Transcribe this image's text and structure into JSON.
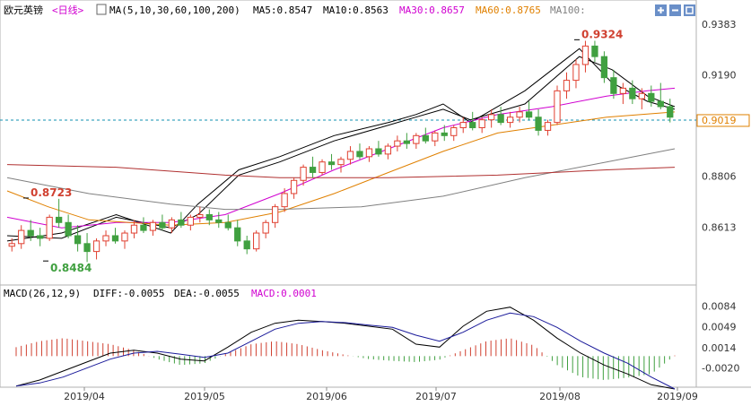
{
  "header": {
    "symbol": "欧元英镑",
    "period": "<日线>",
    "ma_params": "MA(5,10,30,60,100,200)",
    "ma_values": [
      {
        "label": "MA5:0.8547",
        "color": "#000000"
      },
      {
        "label": "MA10:0.8563",
        "color": "#000000"
      },
      {
        "label": "MA30:0.8657",
        "color": "#d000d0"
      },
      {
        "label": "MA60:0.8765",
        "color": "#e08000"
      },
      {
        "label": "MA100:",
        "color": "#808080"
      }
    ],
    "icons": [
      "zoom-in-icon",
      "zoom-out-icon",
      "fullscreen-icon"
    ]
  },
  "macd_header": {
    "params": "MACD(26,12,9)",
    "diff": "DIFF:-0.0055",
    "dea": "DEA:-0.0055",
    "macd": "MACD:0.0001"
  },
  "colors": {
    "up": "#e04030",
    "down": "#40a040",
    "ma5": "#000000",
    "ma10": "#000000",
    "ma30": "#d000d0",
    "ma60": "#e08000",
    "ma100": "#808080",
    "ma200": "#b03030",
    "dash": "#1090b0",
    "macd_pos": "#d04030",
    "macd_neg": "#40a040"
  },
  "chart_data": [
    {
      "type": "candlestick",
      "title": "欧元英镑<日线>",
      "ylim": [
        0.842,
        0.94
      ],
      "y_ticks": [
        0.9383,
        0.919,
        0.9019,
        0.8806,
        0.8613
      ],
      "x_labels": [
        "2019/04",
        "2019/05",
        "2019/06",
        "2019/07",
        "2019/08",
        "2019/09"
      ],
      "current_price": 0.9019,
      "annotations": [
        {
          "text": "0.9324",
          "value": 0.9324,
          "kind": "high"
        },
        {
          "text": "0.8723",
          "value": 0.8723,
          "kind": "high"
        },
        {
          "text": "0.8484",
          "value": 0.8484,
          "kind": "low"
        }
      ],
      "ma_lines": {
        "ma5": [
          [
            0,
            0.856
          ],
          [
            20,
            0.859
          ],
          [
            40,
            0.866
          ],
          [
            60,
            0.859
          ],
          [
            70,
            0.87
          ],
          [
            85,
            0.883
          ],
          [
            100,
            0.888
          ],
          [
            120,
            0.896
          ],
          [
            140,
            0.901
          ],
          [
            150,
            0.904
          ],
          [
            160,
            0.908
          ],
          [
            170,
            0.901
          ],
          [
            190,
            0.913
          ],
          [
            210,
            0.929
          ],
          [
            222,
            0.916
          ],
          [
            235,
            0.909
          ],
          [
            245,
            0.906
          ]
        ],
        "ma10": [
          [
            0,
            0.858
          ],
          [
            20,
            0.857
          ],
          [
            40,
            0.865
          ],
          [
            60,
            0.861
          ],
          [
            70,
            0.866
          ],
          [
            85,
            0.881
          ],
          [
            100,
            0.886
          ],
          [
            120,
            0.894
          ],
          [
            140,
            0.9
          ],
          [
            150,
            0.903
          ],
          [
            160,
            0.906
          ],
          [
            170,
            0.902
          ],
          [
            190,
            0.908
          ],
          [
            210,
            0.926
          ],
          [
            222,
            0.921
          ],
          [
            235,
            0.911
          ],
          [
            245,
            0.907
          ]
        ],
        "ma30": [
          [
            0,
            0.865
          ],
          [
            20,
            0.861
          ],
          [
            40,
            0.863
          ],
          [
            60,
            0.863
          ],
          [
            80,
            0.866
          ],
          [
            100,
            0.874
          ],
          [
            120,
            0.883
          ],
          [
            140,
            0.891
          ],
          [
            160,
            0.899
          ],
          [
            180,
            0.904
          ],
          [
            200,
            0.907
          ],
          [
            220,
            0.911
          ],
          [
            235,
            0.913
          ],
          [
            245,
            0.914
          ]
        ],
        "ma60": [
          [
            0,
            0.875
          ],
          [
            15,
            0.869
          ],
          [
            30,
            0.864
          ],
          [
            60,
            0.862
          ],
          [
            80,
            0.863
          ],
          [
            100,
            0.867
          ],
          [
            120,
            0.874
          ],
          [
            140,
            0.882
          ],
          [
            160,
            0.89
          ],
          [
            180,
            0.897
          ],
          [
            200,
            0.9
          ],
          [
            220,
            0.903
          ],
          [
            245,
            0.905
          ]
        ],
        "ma100": [
          [
            0,
            0.88
          ],
          [
            30,
            0.874
          ],
          [
            60,
            0.87
          ],
          [
            80,
            0.868
          ],
          [
            100,
            0.868
          ],
          [
            130,
            0.869
          ],
          [
            160,
            0.873
          ],
          [
            190,
            0.88
          ],
          [
            220,
            0.886
          ],
          [
            245,
            0.891
          ]
        ],
        "ma200": [
          [
            0,
            0.885
          ],
          [
            40,
            0.884
          ],
          [
            80,
            0.881
          ],
          [
            100,
            0.88
          ],
          [
            140,
            0.88
          ],
          [
            180,
            0.881
          ],
          [
            220,
            0.883
          ],
          [
            245,
            0.884
          ]
        ]
      },
      "candles": [
        [
          0.854,
          0.857,
          0.852,
          0.855
        ],
        [
          0.855,
          0.862,
          0.853,
          0.86
        ],
        [
          0.86,
          0.864,
          0.856,
          0.858
        ],
        [
          0.858,
          0.861,
          0.854,
          0.857
        ],
        [
          0.857,
          0.866,
          0.856,
          0.865
        ],
        [
          0.865,
          0.872,
          0.861,
          0.863
        ],
        [
          0.863,
          0.866,
          0.857,
          0.858
        ],
        [
          0.858,
          0.862,
          0.852,
          0.855
        ],
        [
          0.855,
          0.859,
          0.848,
          0.852
        ],
        [
          0.852,
          0.857,
          0.849,
          0.856
        ],
        [
          0.856,
          0.86,
          0.854,
          0.858
        ],
        [
          0.858,
          0.861,
          0.855,
          0.856
        ],
        [
          0.856,
          0.86,
          0.853,
          0.859
        ],
        [
          0.859,
          0.864,
          0.857,
          0.862
        ],
        [
          0.862,
          0.865,
          0.859,
          0.86
        ],
        [
          0.86,
          0.864,
          0.858,
          0.863
        ],
        [
          0.863,
          0.866,
          0.86,
          0.861
        ],
        [
          0.861,
          0.865,
          0.859,
          0.864
        ],
        [
          0.864,
          0.867,
          0.861,
          0.862
        ],
        [
          0.862,
          0.866,
          0.86,
          0.865
        ],
        [
          0.865,
          0.869,
          0.863,
          0.866
        ],
        [
          0.866,
          0.868,
          0.862,
          0.864
        ],
        [
          0.864,
          0.867,
          0.861,
          0.863
        ],
        [
          0.863,
          0.866,
          0.86,
          0.861
        ],
        [
          0.861,
          0.864,
          0.854,
          0.856
        ],
        [
          0.856,
          0.858,
          0.851,
          0.853
        ],
        [
          0.853,
          0.86,
          0.852,
          0.859
        ],
        [
          0.859,
          0.864,
          0.857,
          0.863
        ],
        [
          0.863,
          0.87,
          0.861,
          0.869
        ],
        [
          0.869,
          0.876,
          0.867,
          0.874
        ],
        [
          0.874,
          0.88,
          0.872,
          0.879
        ],
        [
          0.879,
          0.885,
          0.877,
          0.884
        ],
        [
          0.884,
          0.888,
          0.88,
          0.882
        ],
        [
          0.882,
          0.887,
          0.881,
          0.886
        ],
        [
          0.886,
          0.889,
          0.883,
          0.885
        ],
        [
          0.885,
          0.888,
          0.882,
          0.887
        ],
        [
          0.887,
          0.892,
          0.885,
          0.89
        ],
        [
          0.89,
          0.893,
          0.887,
          0.888
        ],
        [
          0.888,
          0.892,
          0.886,
          0.891
        ],
        [
          0.891,
          0.894,
          0.888,
          0.889
        ],
        [
          0.889,
          0.893,
          0.887,
          0.892
        ],
        [
          0.892,
          0.896,
          0.89,
          0.894
        ],
        [
          0.894,
          0.897,
          0.891,
          0.893
        ],
        [
          0.893,
          0.897,
          0.891,
          0.896
        ],
        [
          0.896,
          0.899,
          0.893,
          0.894
        ],
        [
          0.894,
          0.898,
          0.892,
          0.897
        ],
        [
          0.897,
          0.9,
          0.894,
          0.896
        ],
        [
          0.896,
          0.9,
          0.894,
          0.899
        ],
        [
          0.899,
          0.903,
          0.897,
          0.901
        ],
        [
          0.901,
          0.905,
          0.898,
          0.899
        ],
        [
          0.899,
          0.903,
          0.897,
          0.902
        ],
        [
          0.902,
          0.906,
          0.899,
          0.904
        ],
        [
          0.904,
          0.907,
          0.9,
          0.901
        ],
        [
          0.901,
          0.905,
          0.899,
          0.903
        ],
        [
          0.903,
          0.907,
          0.901,
          0.905
        ],
        [
          0.905,
          0.909,
          0.902,
          0.903
        ],
        [
          0.903,
          0.906,
          0.896,
          0.898
        ],
        [
          0.898,
          0.902,
          0.896,
          0.901
        ],
        [
          0.901,
          0.915,
          0.9,
          0.913
        ],
        [
          0.913,
          0.92,
          0.91,
          0.917
        ],
        [
          0.917,
          0.925,
          0.914,
          0.923
        ],
        [
          0.923,
          0.932,
          0.92,
          0.93
        ],
        [
          0.93,
          0.932,
          0.924,
          0.926
        ],
        [
          0.926,
          0.928,
          0.916,
          0.918
        ],
        [
          0.918,
          0.921,
          0.91,
          0.912
        ],
        [
          0.912,
          0.916,
          0.908,
          0.914
        ],
        [
          0.914,
          0.917,
          0.908,
          0.91
        ],
        [
          0.91,
          0.914,
          0.906,
          0.912
        ],
        [
          0.912,
          0.915,
          0.907,
          0.909
        ],
        [
          0.909,
          0.916,
          0.906,
          0.907
        ],
        [
          0.907,
          0.91,
          0.901,
          0.903
        ]
      ]
    },
    {
      "type": "bar+line",
      "title": "MACD(26,12,9)",
      "ylim": [
        -0.0052,
        0.0092
      ],
      "y_ticks": [
        0.0084,
        0.0049,
        0.0014,
        -0.002
      ],
      "series": [
        {
          "name": "DIFF",
          "values": [
            -0.005,
            -0.004,
            -0.0025,
            -0.001,
            0.0005,
            0.001,
            0.0005,
            -0.0005,
            -0.0008,
            0.0015,
            0.004,
            0.0055,
            0.006,
            0.0058,
            0.0055,
            0.005,
            0.0045,
            0.002,
            0.0015,
            0.005,
            0.0075,
            0.0082,
            0.006,
            0.003,
            0.0005,
            -0.0015,
            -0.003,
            -0.0048,
            -0.0055
          ]
        },
        {
          "name": "DEA",
          "values": [
            -0.005,
            -0.0045,
            -0.0035,
            -0.002,
            -0.0005,
            0.0005,
            0.0008,
            0.0003,
            -0.0002,
            0.0005,
            0.0025,
            0.0045,
            0.0055,
            0.0058,
            0.0056,
            0.0052,
            0.0048,
            0.0035,
            0.0025,
            0.004,
            0.006,
            0.0072,
            0.0066,
            0.0048,
            0.0025,
            0.0005,
            -0.0012,
            -0.0035,
            -0.0055
          ]
        },
        {
          "name": "MACD",
          "values": [
            0.0015,
            0.0025,
            0.003,
            0.0025,
            0.002,
            0.001,
            -0.0005,
            -0.0015,
            -0.0012,
            0.0005,
            0.002,
            0.0025,
            0.002,
            0.001,
            0.0002,
            -0.0005,
            -0.0008,
            -0.001,
            -0.0006,
            0.001,
            0.0025,
            0.003,
            0.0018,
            -0.0015,
            -0.0035,
            -0.004,
            -0.0036,
            -0.003,
            0.0001
          ]
        }
      ]
    }
  ]
}
